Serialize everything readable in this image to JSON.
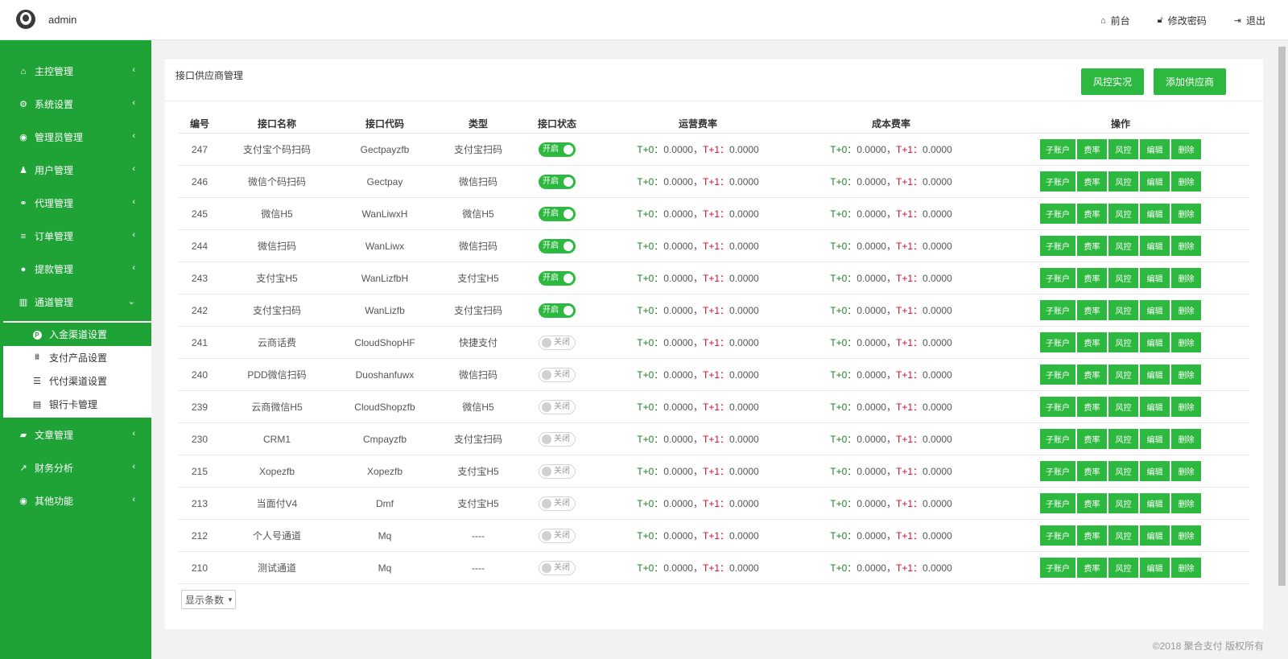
{
  "header": {
    "user": "admin",
    "links": [
      {
        "icon": "home-icon",
        "label": "前台"
      },
      {
        "icon": "lock-icon",
        "label": "修改密码"
      },
      {
        "icon": "logout-icon",
        "label": "退出"
      }
    ]
  },
  "sidebar": {
    "items": [
      {
        "icon": "home-icon",
        "label": "主控管理"
      },
      {
        "icon": "gears-icon",
        "label": "系统设置"
      },
      {
        "icon": "user-circle-icon",
        "label": "管理员管理"
      },
      {
        "icon": "users-icon",
        "label": "用户管理"
      },
      {
        "icon": "handshake-icon",
        "label": "代理管理"
      },
      {
        "icon": "list-icon",
        "label": "订单管理"
      },
      {
        "icon": "money-bag-icon",
        "label": "提款管理"
      },
      {
        "icon": "bank-icon",
        "label": "通道管理"
      }
    ],
    "submenu": [
      {
        "icon": "deposit-icon",
        "label": "入金渠道设置",
        "active": true
      },
      {
        "icon": "sitemap-icon",
        "label": "支付产品设置",
        "active": false
      },
      {
        "icon": "sliders-icon",
        "label": "代付渠道设置",
        "active": false
      },
      {
        "icon": "card-icon",
        "label": "银行卡管理",
        "active": false
      }
    ],
    "items_after": [
      {
        "icon": "book-icon",
        "label": "文章管理"
      },
      {
        "icon": "line-chart-icon",
        "label": "财务分析"
      },
      {
        "icon": "user-circle-icon",
        "label": "其他功能"
      }
    ]
  },
  "card": {
    "title": "接口供应商管理",
    "risk_button": "风控实况",
    "add_button": "添加供应商"
  },
  "table": {
    "headers": [
      "编号",
      "接口名称",
      "接口代码",
      "类型",
      "接口状态",
      "运营费率",
      "成本费率",
      "操作"
    ],
    "fee_labels": {
      "t0": "T+0：",
      "t1": "T+1："
    },
    "actions": [
      "子账户",
      "费率",
      "风控",
      "编辑",
      "删除"
    ],
    "status_on": "开启",
    "status_off": "关闭",
    "rows": [
      {
        "id": "247",
        "name": "支付宝个码扫码",
        "code": "Gectpayzfb",
        "type": "支付宝扫码",
        "on": true,
        "op_t0": "0.0000，",
        "op_t1": "0.0000",
        "cost_t0": "0.0000，",
        "cost_t1": "0.0000"
      },
      {
        "id": "246",
        "name": "微信个码扫码",
        "code": "Gectpay",
        "type": "微信扫码",
        "on": true,
        "op_t0": "0.0000，",
        "op_t1": "0.0000",
        "cost_t0": "0.0000，",
        "cost_t1": "0.0000"
      },
      {
        "id": "245",
        "name": "微信H5",
        "code": "WanLiwxH",
        "type": "微信H5",
        "on": true,
        "op_t0": "0.0000，",
        "op_t1": "0.0000",
        "cost_t0": "0.0000，",
        "cost_t1": "0.0000"
      },
      {
        "id": "244",
        "name": "微信扫码",
        "code": "WanLiwx",
        "type": "微信扫码",
        "on": true,
        "op_t0": "0.0000，",
        "op_t1": "0.0000",
        "cost_t0": "0.0000，",
        "cost_t1": "0.0000"
      },
      {
        "id": "243",
        "name": "支付宝H5",
        "code": "WanLizfbH",
        "type": "支付宝H5",
        "on": true,
        "op_t0": "0.0000，",
        "op_t1": "0.0000",
        "cost_t0": "0.0000，",
        "cost_t1": "0.0000"
      },
      {
        "id": "242",
        "name": "支付宝扫码",
        "code": "WanLizfb",
        "type": "支付宝扫码",
        "on": true,
        "op_t0": "0.0000，",
        "op_t1": "0.0000",
        "cost_t0": "0.0000，",
        "cost_t1": "0.0000"
      },
      {
        "id": "241",
        "name": "云商话费",
        "code": "CloudShopHF",
        "type": "快捷支付",
        "on": false,
        "op_t0": "0.0000，",
        "op_t1": "0.0000",
        "cost_t0": "0.0000，",
        "cost_t1": "0.0000"
      },
      {
        "id": "240",
        "name": "PDD微信扫码",
        "code": "Duoshanfuwx",
        "type": "微信扫码",
        "on": false,
        "op_t0": "0.0000，",
        "op_t1": "0.0000",
        "cost_t0": "0.0000，",
        "cost_t1": "0.0000"
      },
      {
        "id": "239",
        "name": "云商微信H5",
        "code": "CloudShopzfb",
        "type": "微信H5",
        "on": false,
        "op_t0": "0.0000，",
        "op_t1": "0.0000",
        "cost_t0": "0.0000，",
        "cost_t1": "0.0000"
      },
      {
        "id": "230",
        "name": "CRM1",
        "code": "Cmpayzfb",
        "type": "支付宝扫码",
        "on": false,
        "op_t0": "0.0000，",
        "op_t1": "0.0000",
        "cost_t0": "0.0000，",
        "cost_t1": "0.0000"
      },
      {
        "id": "215",
        "name": "Xopezfb",
        "code": "Xopezfb",
        "type": "支付宝H5",
        "on": false,
        "op_t0": "0.0000，",
        "op_t1": "0.0000",
        "cost_t0": "0.0000，",
        "cost_t1": "0.0000"
      },
      {
        "id": "213",
        "name": "当面付V4",
        "code": "Dmf",
        "type": "支付宝H5",
        "on": false,
        "op_t0": "0.0000，",
        "op_t1": "0.0000",
        "cost_t0": "0.0000，",
        "cost_t1": "0.0000"
      },
      {
        "id": "212",
        "name": "个人号通道",
        "code": "Mq",
        "type": "----",
        "on": false,
        "op_t0": "0.0000，",
        "op_t1": "0.0000",
        "cost_t0": "0.0000，",
        "cost_t1": "0.0000"
      },
      {
        "id": "210",
        "name": "测试通道",
        "code": "Mq",
        "type": "----",
        "on": false,
        "op_t0": "0.0000，",
        "op_t1": "0.0000",
        "cost_t0": "0.0000，",
        "cost_t1": "0.0000"
      }
    ]
  },
  "pager": {
    "label": "显示条数"
  },
  "footer": "©2018 聚合支付 版权所有",
  "colors": {
    "sidebar": "#1fa337",
    "button": "#2db83f",
    "t0": "#1a7d2a",
    "t1": "#c8102e"
  }
}
